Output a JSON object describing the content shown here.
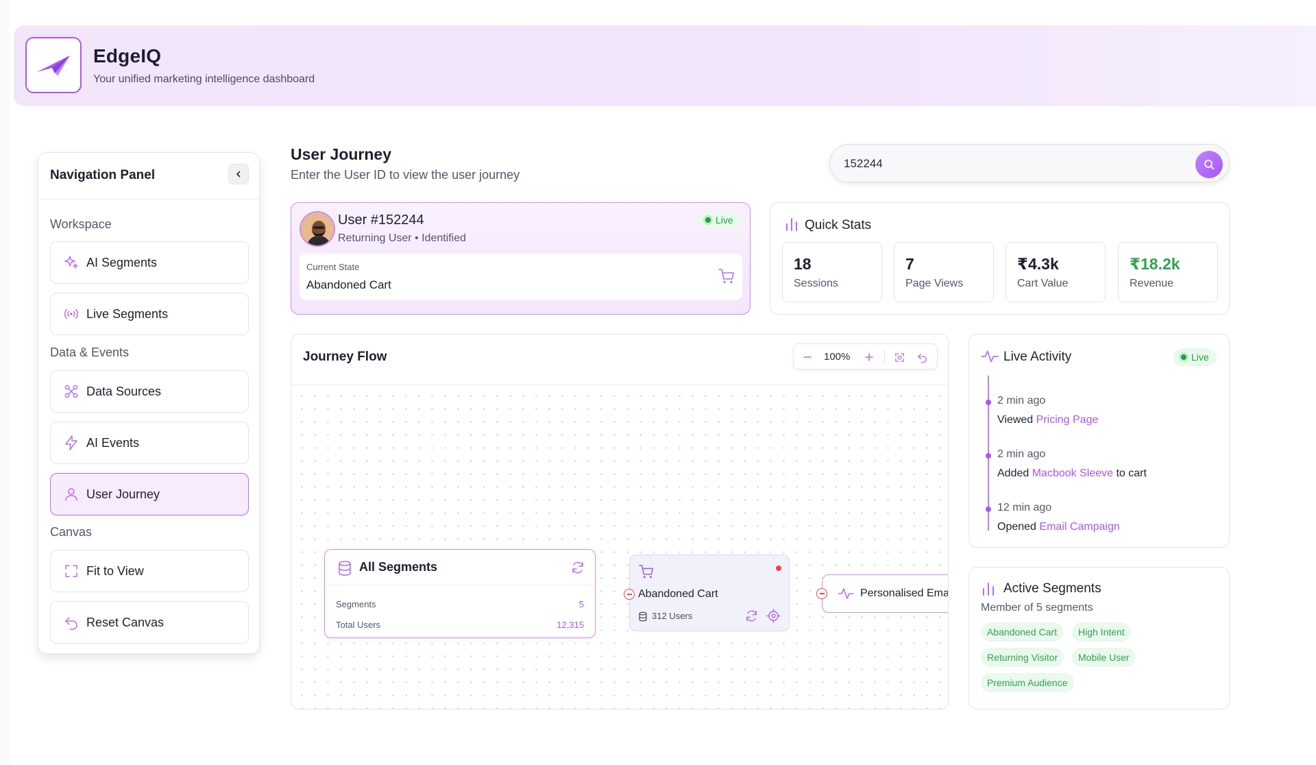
{
  "app": {
    "title": "EdgeIQ",
    "subtitle": "Your unified marketing intelligence dashboard"
  },
  "nav": {
    "title": "Navigation Panel",
    "groups": [
      {
        "label": "Workspace"
      },
      {
        "label": "Data & Events"
      },
      {
        "label": "Canvas"
      }
    ],
    "items": [
      {
        "label": "AI Segments",
        "icon": "sparkles-icon"
      },
      {
        "label": "Live Segments",
        "icon": "broadcast-icon"
      },
      {
        "label": "Data Sources",
        "icon": "graph-nodes-icon"
      },
      {
        "label": "AI Events",
        "icon": "lightning-icon"
      },
      {
        "label": "User Journey",
        "icon": "user-icon",
        "active": true
      },
      {
        "label": "Fit to View",
        "icon": "fit-frame-icon"
      },
      {
        "label": "Reset Canvas",
        "icon": "undo-icon"
      }
    ]
  },
  "page": {
    "title": "User Journey",
    "subtitle": "Enter the User ID to view the user journey"
  },
  "search": {
    "value": "152244"
  },
  "user": {
    "name": "User #152244",
    "meta": "Returning User • Identified",
    "status": "Live",
    "state_label": "Current State",
    "state_value": "Abandoned Cart"
  },
  "quick_stats": {
    "title": "Quick Stats",
    "items": [
      {
        "value": "18",
        "label": "Sessions"
      },
      {
        "value": "7",
        "label": "Page Views"
      },
      {
        "value": "₹4.3k",
        "label": "Cart Value"
      },
      {
        "value": "₹18.2k",
        "label": "Revenue",
        "accent": "#2fa44f"
      }
    ]
  },
  "journey_flow": {
    "title": "Journey Flow",
    "zoom": "100%",
    "nodes": {
      "all_segments": {
        "title": "All Segments",
        "rows": [
          {
            "label": "Segments",
            "value": "5"
          },
          {
            "label": "Total Users",
            "value": "12,315"
          }
        ]
      },
      "abandoned_cart": {
        "title": "Abandoned Cart",
        "users": "312 Users"
      },
      "email": {
        "title": "Personalised Ema"
      }
    }
  },
  "live_activity": {
    "title": "Live Activity",
    "status": "Live",
    "events": [
      {
        "time": "2 min ago",
        "prefix": "Viewed ",
        "link": "Pricing Page",
        "suffix": ""
      },
      {
        "time": "2 min ago",
        "prefix": "Added ",
        "link": "Macbook Sleeve",
        "suffix": " to cart"
      },
      {
        "time": "12 min ago",
        "prefix": "Opened ",
        "link": "Email Campaign",
        "suffix": ""
      }
    ]
  },
  "active_segments": {
    "title": "Active Segments",
    "subtitle": "Member of 5 segments",
    "chips": [
      "Abandoned Cart",
      "High Intent",
      "Returning Visitor",
      "Mobile User",
      "Premium Audience"
    ]
  },
  "colors": {
    "accent": "#a855f7",
    "live_green": "#22a046",
    "header_bg": "#f2e6fb"
  }
}
